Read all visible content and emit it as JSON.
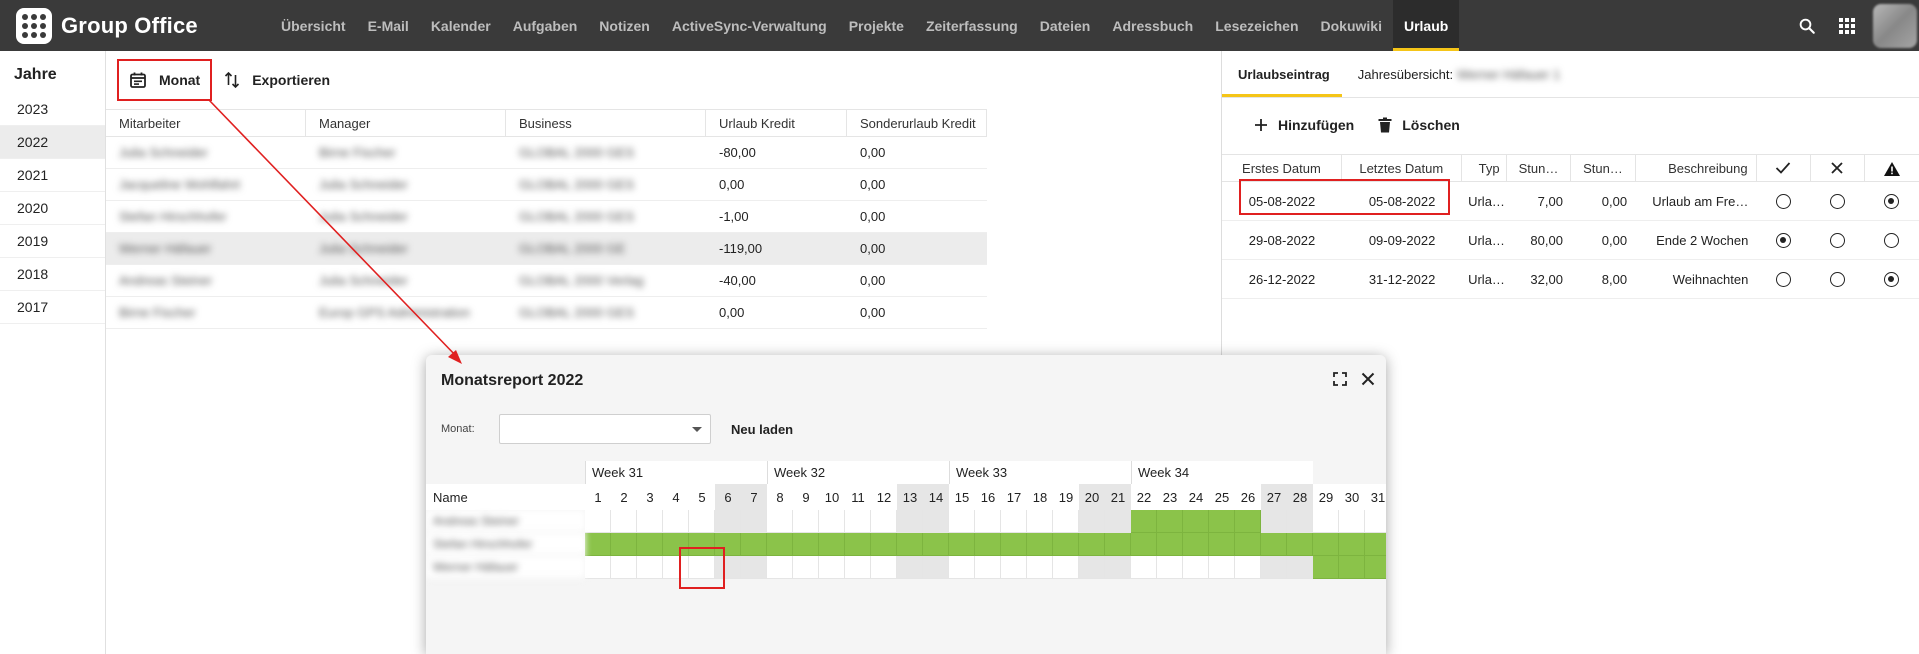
{
  "app": {
    "title": "Group Office"
  },
  "nav": [
    {
      "label": "Übersicht"
    },
    {
      "label": "E-Mail"
    },
    {
      "label": "Kalender"
    },
    {
      "label": "Aufgaben"
    },
    {
      "label": "Notizen"
    },
    {
      "label": "ActiveSync-Verwaltung"
    },
    {
      "label": "Projekte"
    },
    {
      "label": "Zeiterfassung"
    },
    {
      "label": "Dateien"
    },
    {
      "label": "Adressbuch"
    },
    {
      "label": "Lesezeichen"
    },
    {
      "label": "Dokuwiki"
    },
    {
      "label": "Urlaub",
      "active": true
    }
  ],
  "years": {
    "title": "Jahre",
    "items": [
      "2023",
      "2022",
      "2021",
      "2020",
      "2019",
      "2018",
      "2017"
    ],
    "selected": "2022"
  },
  "toolbar": {
    "month_label": "Monat",
    "export_label": "Exportieren"
  },
  "employees": {
    "columns": [
      "Mitarbeiter",
      "Manager",
      "Business",
      "Urlaub Kredit",
      "Sonderurlaub Kredit"
    ],
    "rows": [
      {
        "name": "Julia Schneider",
        "manager": "Birne Fischer",
        "business": "GLOBAL 2000 GES",
        "credit": "-80,00",
        "special": "0,00"
      },
      {
        "name": "Jacqueline Wohlfahrt",
        "manager": "Julia Schneider",
        "business": "GLOBAL 2000 GES",
        "credit": "0,00",
        "special": "0,00"
      },
      {
        "name": "Stefan Hirschhofer",
        "manager": "Julia Schneider",
        "business": "GLOBAL 2000 GES",
        "credit": "-1,00",
        "special": "0,00"
      },
      {
        "name": "Werner Häfauer",
        "manager": "Julia Schneider",
        "business": "GLOBAL 2000 GE",
        "credit": "-119,00",
        "special": "0,00",
        "selected": true
      },
      {
        "name": "Andreas Steiner",
        "manager": "Julia Schneider",
        "business": "GLOBAL 2000 Verlag",
        "credit": "-40,00",
        "special": "0,00"
      },
      {
        "name": "Birne Fischer",
        "manager": "Europ GPS Administration",
        "business": "GLOBAL 2000 GES",
        "credit": "0,00",
        "special": "0,00"
      }
    ]
  },
  "right_panel": {
    "tabs": [
      {
        "label": "Urlaubseintrag",
        "active": true
      },
      {
        "label": "Jahresübersicht:",
        "suffix": "Werner Häfauer 1"
      }
    ],
    "add_label": "Hinzufügen",
    "delete_label": "Löschen",
    "columns": [
      "Erstes Datum",
      "Letztes Datum",
      "Typ",
      "Stun…",
      "Stun…",
      "Beschreibung"
    ],
    "entries": [
      {
        "first": "05-08-2022",
        "last": "05-08-2022",
        "type": "Urla…",
        "hours1": "7,00",
        "hours2": "0,00",
        "desc": "Urlaub am Fre…",
        "state": "warning"
      },
      {
        "first": "29-08-2022",
        "last": "09-09-2022",
        "type": "Urla…",
        "hours1": "80,00",
        "hours2": "0,00",
        "desc": "Ende 2 Wochen",
        "state": "approved"
      },
      {
        "first": "26-12-2022",
        "last": "31-12-2022",
        "type": "Urla…",
        "hours1": "32,00",
        "hours2": "8,00",
        "desc": "Weihnachten",
        "state": "warning"
      }
    ]
  },
  "dialog": {
    "title": "Monatsreport 2022",
    "month_label": "Monat:",
    "month_value": "",
    "reload_label": "Neu laden",
    "name_header": "Name",
    "weeks": [
      {
        "label": "Week 31",
        "days": 7
      },
      {
        "label": "Week 32",
        "days": 7
      },
      {
        "label": "Week 33",
        "days": 7
      },
      {
        "label": "Week 34",
        "days": 7
      },
      {
        "label": "",
        "days": 3
      }
    ],
    "days": [
      "1",
      "2",
      "3",
      "4",
      "5",
      "6",
      "7",
      "8",
      "9",
      "10",
      "11",
      "12",
      "13",
      "14",
      "15",
      "16",
      "17",
      "18",
      "19",
      "20",
      "21",
      "22",
      "23",
      "24",
      "25",
      "26",
      "27",
      "28",
      "29",
      "30",
      "31"
    ],
    "weekend_days": [
      6,
      7,
      13,
      14,
      20,
      21,
      27,
      28
    ],
    "people": [
      {
        "name": "Andreas Steiner",
        "vacation_days": [
          22,
          23,
          24,
          25,
          26
        ]
      },
      {
        "name": "Stefan Hirschhofer",
        "vacation_days": [
          1,
          2,
          3,
          4,
          5,
          6,
          7,
          8,
          9,
          10,
          11,
          12,
          13,
          14,
          15,
          16,
          17,
          18,
          19,
          20,
          21,
          22,
          23,
          24,
          25,
          26,
          27,
          28,
          29,
          30,
          31
        ]
      },
      {
        "name": "Werner Häfauer",
        "vacation_days": [
          29,
          30,
          31
        ]
      }
    ]
  },
  "colors": {
    "accent": "#f5c518",
    "vacation": "#8bc34a",
    "highlight": "#e02020",
    "topbar": "#3a3a3a"
  }
}
